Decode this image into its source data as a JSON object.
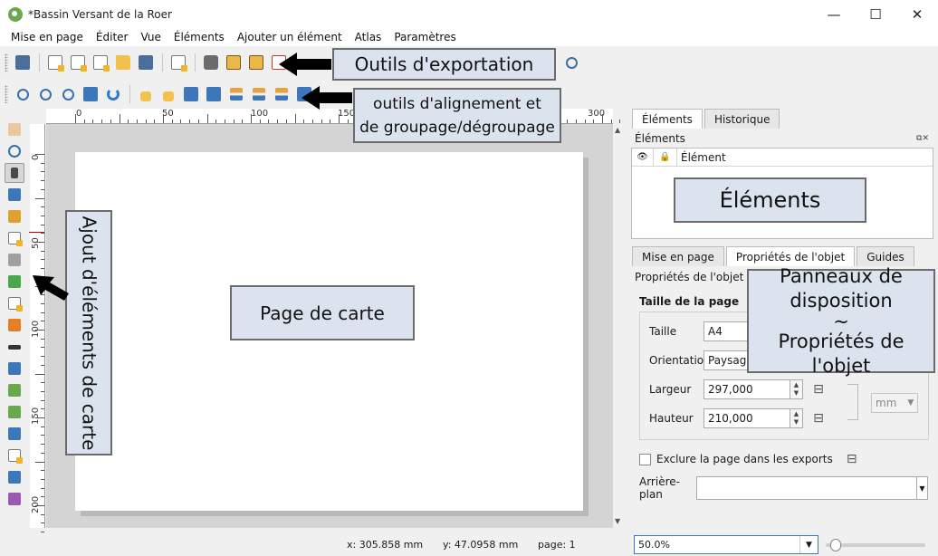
{
  "window": {
    "title": "*Bassin Versant de la Roer",
    "minimize": "—",
    "maximize": "☐",
    "close": "✕"
  },
  "menu": [
    "Mise en page",
    "Éditer",
    "Vue",
    "Éléments",
    "Ajouter un élément",
    "Atlas",
    "Paramètres"
  ],
  "rulers": {
    "horizontal": [
      "0",
      "50",
      "100",
      "150",
      "300"
    ],
    "vertical": [
      "0",
      "50",
      "100",
      "150",
      "200"
    ]
  },
  "callouts": {
    "export": "Outils d'exportation",
    "align_line1": "outils d'alignement et",
    "align_line2": "de groupage/dégroupage",
    "add_items": "Ajout d'éléments de carte",
    "page": "Page de carte",
    "elements": "Éléments",
    "panels_line1": "Panneaux de",
    "panels_line2": "disposition",
    "panels_line3": "~",
    "panels_line4": "Propriétés de l'objet"
  },
  "dock": {
    "top_tabs": [
      "Éléments",
      "Historique"
    ],
    "elements_title": "Éléments",
    "elements_header": {
      "visible": "👁",
      "locked": "🔒",
      "element": "Élément"
    },
    "bottom_tabs": [
      "Mise en page",
      "Propriétés de l'objet",
      "Guides"
    ],
    "props_title": "Propriétés de l'objet",
    "page_size_title": "Taille de la page",
    "size_label": "Taille",
    "size_value": "A4",
    "orientation_label": "Orientation",
    "orientation_value": "Paysage",
    "width_label": "Largeur",
    "width_value": "297,000",
    "height_label": "Hauteur",
    "height_value": "210,000",
    "unit_value": "mm",
    "exclude_label": "Exclure la page dans les exports",
    "background_label": "Arrière-plan"
  },
  "status": {
    "x": "x: 305.858 mm",
    "y": "y: 47.0958 mm",
    "page": "page: 1",
    "zoom": "50.0%",
    "zoom_slider_fraction": 0.05
  }
}
